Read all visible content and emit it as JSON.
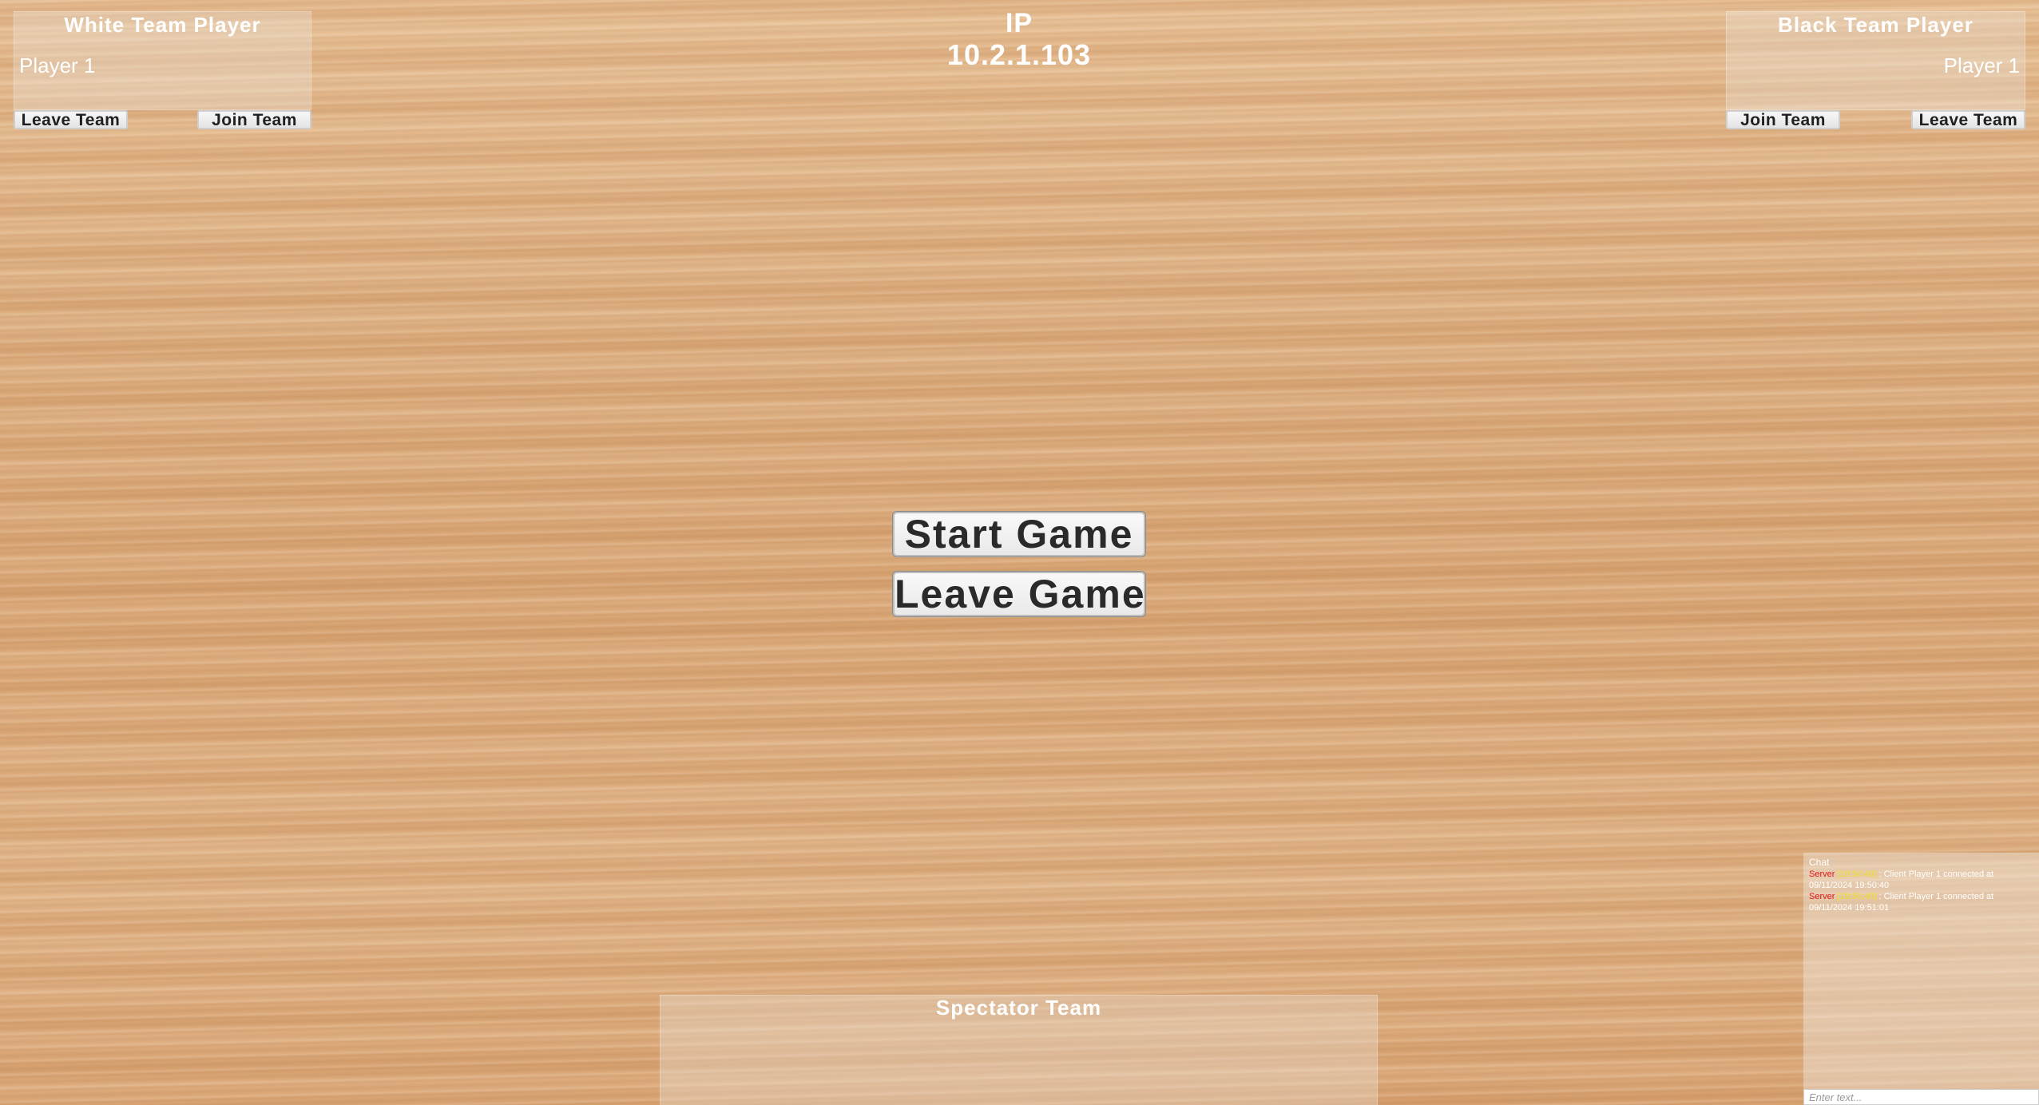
{
  "white_team": {
    "title": "White Team Player",
    "player": "Player 1",
    "leave_label": "Leave Team",
    "join_label": "Join Team"
  },
  "server": {
    "ip_label": "IP",
    "ip_value": "10.2.1.103"
  },
  "black_team": {
    "title": "Black Team Player",
    "player": "Player 1",
    "join_label": "Join Team",
    "leave_label": "Leave Team"
  },
  "menu": {
    "start_label": "Start Game",
    "leave_label": "Leave Game"
  },
  "spectator_team": {
    "title": "Spectator Team"
  },
  "chat": {
    "title": "Chat",
    "messages": [
      {
        "sender": "Server",
        "time": "[19:50:40]",
        "text": ": Client Player 1 connected at 09/11/2024 19:50:40"
      },
      {
        "sender": "Server",
        "time": "[19:50:40]",
        "text": ": Client Player 1 connected at 09/11/2024 19:51:01"
      }
    ],
    "input_placeholder": "Enter text..."
  },
  "colors": {
    "chat_sender": "#e01818",
    "chat_time": "#f2e020",
    "panel_text": "#ffffff",
    "button_text": "#202020"
  }
}
